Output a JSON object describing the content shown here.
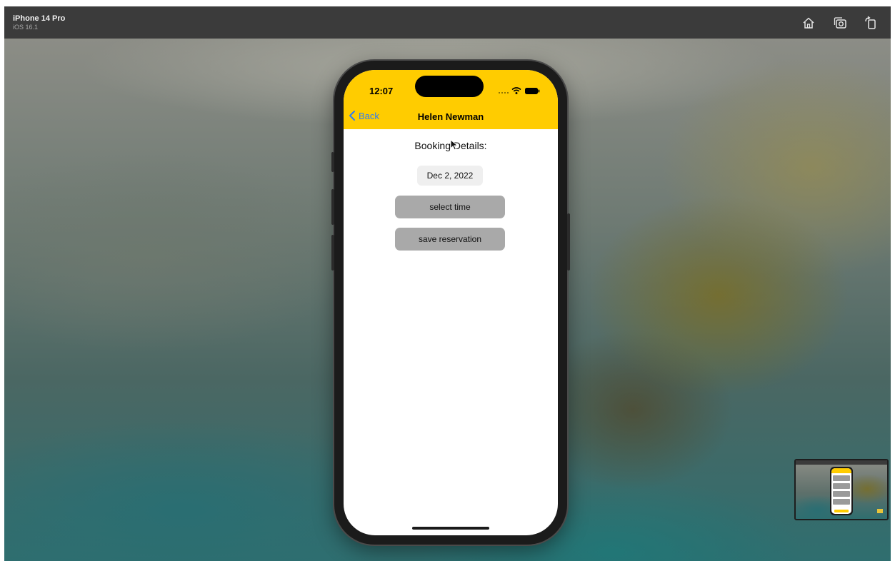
{
  "simulator": {
    "device_name": "iPhone 14 Pro",
    "os_version": "iOS 16.1",
    "toolbar_icons": [
      "home-icon",
      "screenshot-icon",
      "rotate-icon"
    ]
  },
  "status_bar": {
    "time": "12:07",
    "icons": [
      "cellular-dots-icon",
      "wifi-icon",
      "battery-icon"
    ]
  },
  "nav": {
    "back_label": "Back",
    "title": "Helen Newman"
  },
  "content": {
    "heading": "Booking Details:",
    "date_value": "Dec 2, 2022",
    "select_time_label": "select time",
    "save_reservation_label": "save reservation"
  },
  "colors": {
    "header_yellow": "#ffcc00",
    "back_blue": "#2f7cf6",
    "button_gray": "#a9a9a9",
    "date_chip_gray": "#efefef"
  }
}
